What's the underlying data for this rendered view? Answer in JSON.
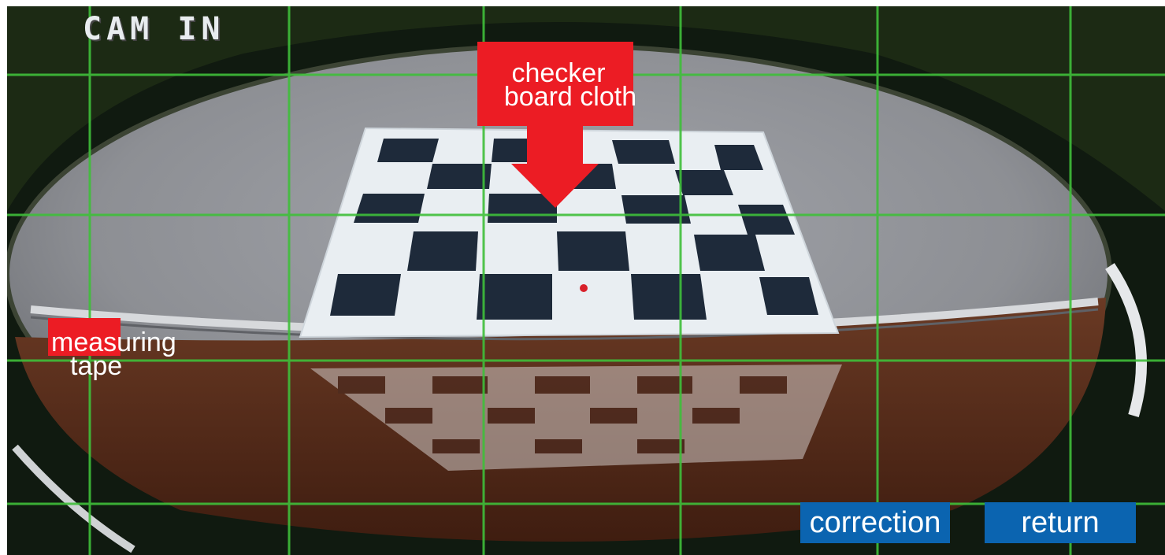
{
  "camera": {
    "label": "CAM IN"
  },
  "callouts": {
    "checker": {
      "line1": "checker",
      "line2": "board cloth"
    },
    "tape": {
      "line1": "measuring",
      "line2": "tape"
    }
  },
  "buttons": {
    "correction": "correction",
    "return": "return"
  },
  "colors": {
    "callout_red": "#ec1c24",
    "button_blue": "#0b64b0",
    "grid_green": "#3fbf3a"
  }
}
